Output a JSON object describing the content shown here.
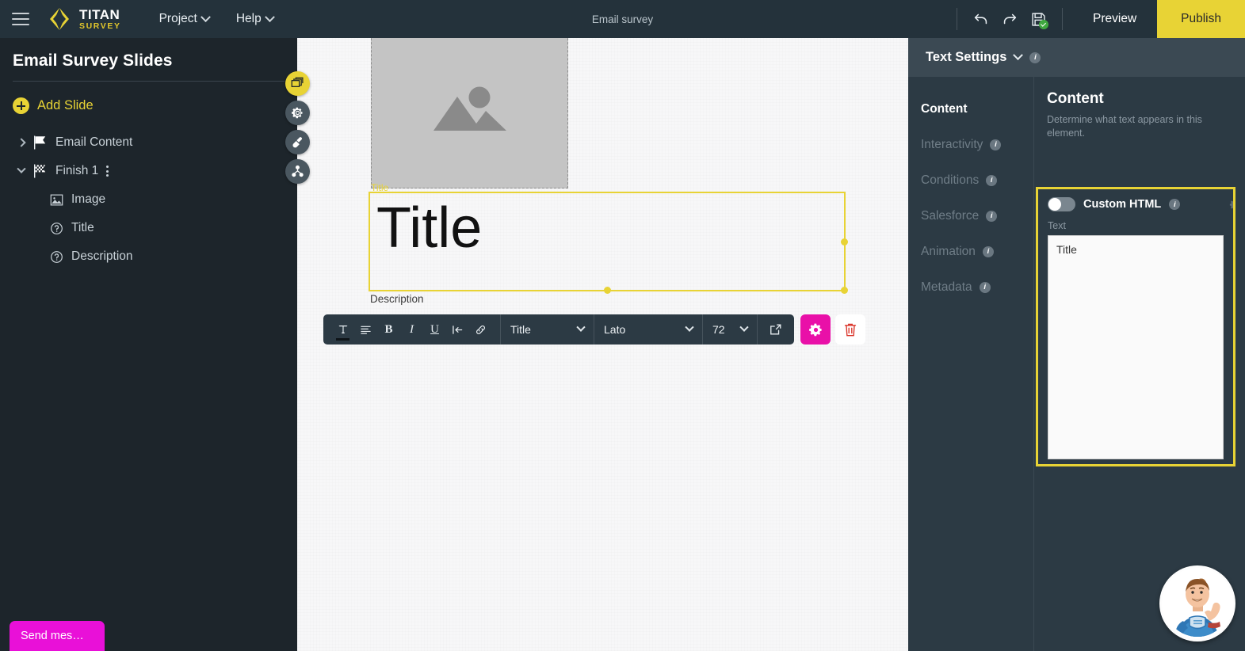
{
  "topbar": {
    "brand_line1": "TITAN",
    "brand_line2": "SURVEY",
    "menus": [
      {
        "label": "Project"
      },
      {
        "label": "Help"
      }
    ],
    "document_title": "Email survey",
    "undo_title": "Undo",
    "redo_title": "Redo",
    "save_title": "Save",
    "preview_label": "Preview",
    "publish_label": "Publish"
  },
  "sidebar": {
    "title": "Email Survey Slides",
    "add_slide_label": "Add Slide",
    "tree": [
      {
        "label": "Email Content",
        "icon": "flag-icon",
        "expanded": false,
        "level": 1
      },
      {
        "label": "Finish 1",
        "icon": "checkered-flag-icon",
        "expanded": true,
        "level": 1,
        "has_menu": true
      },
      {
        "label": "Image",
        "icon": "image-icon",
        "level": 2
      },
      {
        "label": "Title",
        "icon": "question-icon",
        "level": 2
      },
      {
        "label": "Description",
        "icon": "question-icon",
        "level": 2
      }
    ],
    "send_message_label": "Send mes…"
  },
  "rail": [
    {
      "name": "slides-icon",
      "active": true
    },
    {
      "name": "settings-gear-icon",
      "active": false
    },
    {
      "name": "theme-brush-icon",
      "active": false
    },
    {
      "name": "flow-nodes-icon",
      "active": false
    }
  ],
  "canvas": {
    "image_tag": "Title",
    "title_text": "Title",
    "description_tag": "Description"
  },
  "format_toolbar": {
    "text_tool": "T",
    "align_tool": "align-left",
    "bold": "B",
    "italic": "I",
    "underline": "U",
    "indent": "indent",
    "link": "link",
    "style_value": "Title",
    "font_value": "Lato",
    "size_value": "72",
    "popout": "open-external",
    "settings": "gear",
    "delete": "trash"
  },
  "right_panel": {
    "header_title": "Text Settings",
    "nav": [
      {
        "label": "Content",
        "active": true,
        "has_info": false
      },
      {
        "label": "Interactivity",
        "active": false,
        "has_info": true
      },
      {
        "label": "Conditions",
        "active": false,
        "has_info": true
      },
      {
        "label": "Salesforce",
        "active": false,
        "has_info": true
      },
      {
        "label": "Animation",
        "active": false,
        "has_info": true
      },
      {
        "label": "Metadata",
        "active": false,
        "has_info": true
      }
    ],
    "content_heading": "Content",
    "content_subtitle": "Determine what text appears in this element.",
    "custom_html_label": "Custom HTML",
    "custom_html_enabled": false,
    "text_label": "Text",
    "text_value": "Title"
  },
  "colors": {
    "brand_yellow": "#e8d335",
    "topbar_bg": "#24323b",
    "sidebar_bg": "#1d252b",
    "panel_bg": "#2c3a44",
    "panel_header_bg": "#3b4953",
    "canvas_bg": "#f7f7f8",
    "magenta": "#e910a8",
    "send_pink": "#e910d8",
    "trash_red": "#d93025",
    "saved_green": "#3fa83f"
  },
  "avatar": {
    "name": "support-assistant-avatar"
  }
}
